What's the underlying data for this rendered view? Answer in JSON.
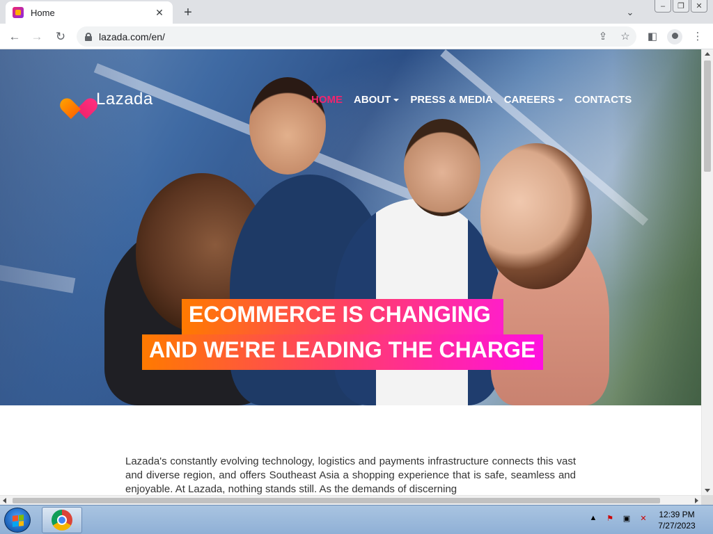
{
  "browser": {
    "tab_title": "Home",
    "url": "lazada.com/en/",
    "new_tab_symbol": "+",
    "close_symbol": "✕"
  },
  "page": {
    "logo_text": "Lazada",
    "nav": [
      {
        "label": "HOME",
        "active": true,
        "has_caret": false
      },
      {
        "label": "ABOUT",
        "active": false,
        "has_caret": true
      },
      {
        "label": "PRESS & MEDIA",
        "active": false,
        "has_caret": false
      },
      {
        "label": "CAREERS",
        "active": false,
        "has_caret": true
      },
      {
        "label": "CONTACTS",
        "active": false,
        "has_caret": false
      }
    ],
    "headline_line1": "ECOMMERCE IS CHANGING",
    "headline_line2": "AND WE'RE LEADING THE CHARGE",
    "body_text": "Lazada's constantly evolving technology, logistics and payments infrastructure connects this vast and diverse region, and offers Southeast Asia a shopping experience that is safe, seamless and enjoyable. At Lazada, nothing stands still. As the demands of discerning"
  },
  "colors": {
    "accent_pink": "#f0246e",
    "gradient_orange": "#ff7a00",
    "gradient_magenta": "#ff1fc8"
  },
  "taskbar": {
    "time": "12:39 PM",
    "date": "7/27/2023"
  }
}
